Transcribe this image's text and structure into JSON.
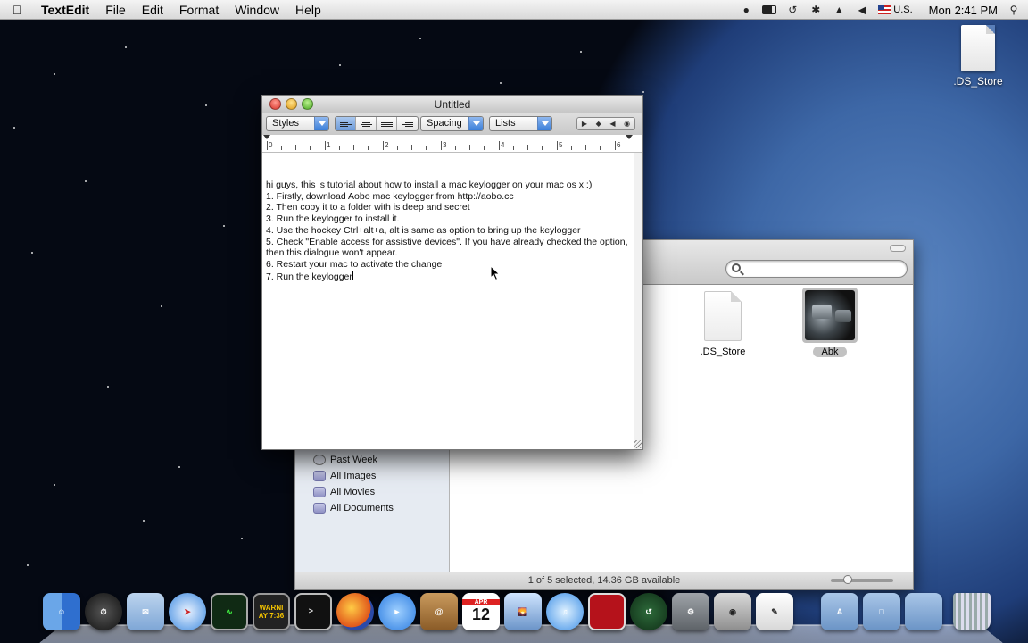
{
  "menubar": {
    "app_name": "TextEdit",
    "menus": [
      "File",
      "Edit",
      "Format",
      "Window",
      "Help"
    ],
    "input_source": "U.S.",
    "clock": "Mon 2:41 PM"
  },
  "desktop": {
    "icons": [
      {
        "label": ".DS_Store"
      }
    ]
  },
  "textedit": {
    "title": "Untitled",
    "toolbar": {
      "styles_label": "Styles",
      "spacing_label": "Spacing",
      "lists_label": "Lists"
    },
    "ruler_numbers": [
      "0",
      "1",
      "2",
      "3",
      "4",
      "5",
      "6"
    ],
    "lines": [
      "hi guys, this is tutorial about how to install a mac keylogger on your mac os x :)",
      "1. Firstly, download Aobo mac keylogger from http://aobo.cc",
      "2. Then copy it to a folder with is deep and secret",
      "3. Run the keylogger to install it.",
      "4. Use the hockey Ctrl+alt+a, alt is same as option to bring up the keylogger",
      "5. Check \"Enable access for assistive devices\". If you have already checked the option, then this dialogue won't appear.",
      "6. Restart your mac to activate the change",
      "7. Run the keylogger"
    ]
  },
  "finder": {
    "sidebar_items": [
      {
        "label": "Past Week",
        "icon": "clock-icon"
      },
      {
        "label": "All Images",
        "icon": "smart-folder-icon"
      },
      {
        "label": "All Movies",
        "icon": "smart-folder-icon"
      },
      {
        "label": "All Documents",
        "icon": "smart-folder-icon"
      }
    ],
    "files": [
      {
        "label": ".DS_Store",
        "selected": false
      },
      {
        "label": "Abk",
        "selected": true
      }
    ],
    "status": "1 of 5 selected, 14.36 GB available"
  },
  "dock": {
    "items": [
      "finder",
      "dashboard",
      "mail",
      "safari",
      "activity-monitor",
      "console",
      "terminal",
      "firefox",
      "ichat",
      "address-book",
      "ical",
      "iphoto",
      "itunes",
      "photo-booth",
      "time-machine",
      "system-preferences",
      "image-capture",
      "textedit",
      "applications-folder",
      "documents-folder",
      "downloads-folder",
      "trash"
    ],
    "ical_day": "12",
    "ical_month": "APR",
    "console_text": "WARNI AY 7:36"
  }
}
